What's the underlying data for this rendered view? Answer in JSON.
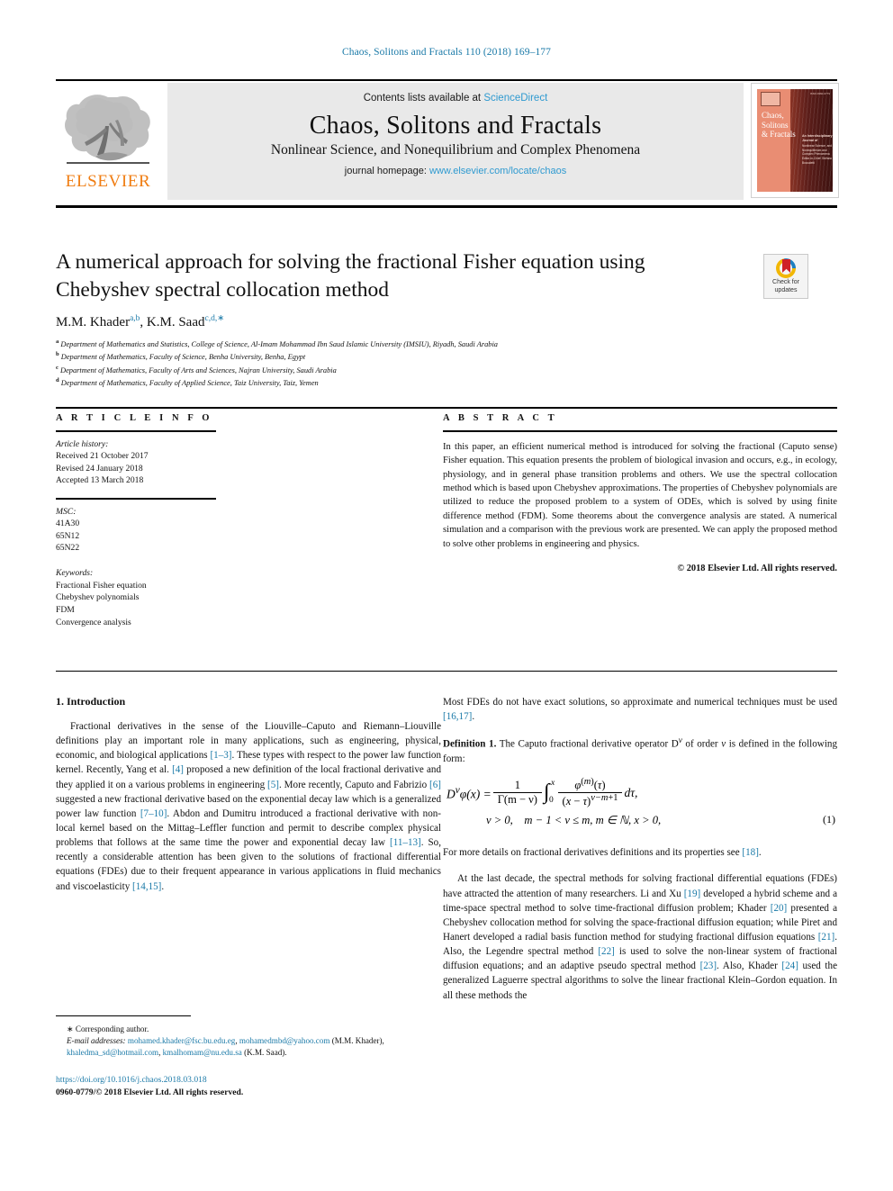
{
  "running_head": "Chaos, Solitons and Fractals 110 (2018) 169–177",
  "masthead": {
    "contents_prefix": "Contents lists available at ",
    "contents_link": "ScienceDirect",
    "journal_title": "Chaos, Solitons and Fractals",
    "journal_subtitle": "Nonlinear Science, and Nonequilibrium and Complex Phenomena",
    "homepage_label": "journal homepage: ",
    "homepage_url": "www.elsevier.com/locate/chaos",
    "publisher": "ELSEVIER",
    "publisher_color": "#f07d12",
    "link_color": "#2f9ad0",
    "cover": {
      "title_line1": "Chaos,",
      "title_line2": "Solitons",
      "title_line3": "& Fractals",
      "code": "ISSN 0960-0779",
      "blurb_bold": "An Interdisciplinary Journal of",
      "blurb": "Nonlinear Science, and Nonequilibrium and Complex Phenomena",
      "blurb_editor": "Editor-in-Chief: Stefano Boccaletti"
    }
  },
  "article": {
    "title": "A numerical approach for solving the fractional Fisher equation using Chebyshev spectral collocation method",
    "authors_html": "M.M. Khader<sup>a,b</sup>, K.M. Saad<sup>c,d,∗</sup>",
    "affiliations": [
      {
        "marker": "a",
        "text": "Department of Mathematics and Statistics, College of Science, Al-Imam Mohammad Ibn Saud Islamic University (IMSIU), Riyadh, Saudi Arabia"
      },
      {
        "marker": "b",
        "text": "Department of Mathematics, Faculty of Science, Benha University, Benha, Egypt"
      },
      {
        "marker": "c",
        "text": "Department of Mathematics, Faculty of Arts and Sciences, Najran University, Saudi Arabia"
      },
      {
        "marker": "d",
        "text": "Department of Mathematics, Faculty of Applied Science, Taiz University, Taiz, Yemen"
      }
    ],
    "crossmark": {
      "line1": "Check for",
      "line2": "updates"
    }
  },
  "article_info": {
    "heading": "A R T I C L E   I N F O",
    "history_label": "Article history:",
    "history": [
      "Received 21 October 2017",
      "Revised 24 January 2018",
      "Accepted 13 March 2018"
    ],
    "msc_label": "MSC:",
    "msc": [
      "41A30",
      "65N12",
      "65N22"
    ],
    "keywords_label": "Keywords:",
    "keywords": [
      "Fractional Fisher equation",
      "Chebyshev polynomials",
      "FDM",
      "Convergence analysis"
    ]
  },
  "abstract": {
    "heading": "A B S T R A C T",
    "text": "In this paper, an efficient numerical method is introduced for solving the fractional (Caputo sense) Fisher equation. This equation presents the problem of biological invasion and occurs, e.g., in ecology, physiology, and in general phase transition problems and others. We use the spectral collocation method which is based upon Chebyshev approximations. The properties of Chebyshev polynomials are utilized to reduce the proposed problem to a system of ODEs, which is solved by using finite difference method (FDM). Some theorems about the convergence analysis are stated. A numerical simulation and a comparison with the previous work are presented. We can apply the proposed method to solve other problems in engineering and physics.",
    "rights": "© 2018 Elsevier Ltd. All rights reserved."
  },
  "body": {
    "section1_heading": "1. Introduction",
    "left_para1_a": "Fractional derivatives in the sense of the Liouville–Caputo and Riemann–Liouville definitions play an important role in many applications, such as engineering, physical, economic, and biological applications ",
    "left_cite_1_3": "[1–3]",
    "left_para1_b": ". These types with respect to the power law function kernel. Recently, Yang et al. ",
    "left_cite_4": "[4]",
    "left_para1_c": " proposed a new definition of the local fractional derivative and they applied it on a various problems in engineering ",
    "left_cite_5": "[5]",
    "left_para1_d": ". More recently, Caputo and Fabrizio ",
    "left_cite_6": "[6]",
    "left_para1_e": " suggested a new fractional derivative based on the exponential decay law which is a generalized power law function ",
    "left_cite_7_10": "[7–10]",
    "left_para1_f": ". Abdon and Dumitru introduced a fractional derivative with non-local kernel based on the Mittag–Leffler function and permit to describe complex physical problems that follows at the same time the power and exponential decay law ",
    "left_cite_11_13": "[11–13]",
    "left_para1_g": ". So, recently a considerable attention has been given to the solutions of fractional differential equations (FDEs) due to their frequent appearance in various applications in fluid mechanics and viscoelasticity ",
    "left_cite_14_15": "[14,15]",
    "left_para1_h": ".",
    "right_para1_a": "Most FDEs do not have exact solutions, so approximate and numerical techniques must be used ",
    "right_cite_16_17": "[16,17]",
    "right_para1_b": ".",
    "definition_label": "Definition 1.",
    "definition_text": " The Caputo fractional derivative operator D",
    "definition_text2": " of order ",
    "definition_text3": " is defined in the following form:",
    "equation1": {
      "lhs": "Dνφ(x) =",
      "frac_num": "1",
      "frac_den": "Γ(m − ν)",
      "integral_upper": "x",
      "integral_lower": "0",
      "inner_num": "φ(m)(τ)",
      "inner_den": "(x − τ)ν−m+1",
      "tail": "dτ,",
      "conditions": "ν > 0, m − 1 < ν ≤ m, m ∈ ℕ, x > 0,",
      "number": "(1)"
    },
    "right_para2_a": "For more details on fractional derivatives definitions and its properties see ",
    "right_cite_18": "[18]",
    "right_para2_b": ".",
    "right_para3_a": "At the last decade, the spectral methods for solving fractional differential equations (FDEs) have attracted the attention of many researchers. Li and Xu ",
    "right_cite_19": "[19]",
    "right_para3_b": " developed a hybrid scheme and a time-space spectral method to solve time-fractional diffusion problem; Khader ",
    "right_cite_20": "[20]",
    "right_para3_c": " presented a Chebyshev collocation method for solving the space-fractional diffusion equation; while Piret and Hanert developed a radial basis function method for studying fractional diffusion equations ",
    "right_cite_21": "[21]",
    "right_para3_d": ". Also, the Legendre spectral method ",
    "right_cite_22": "[22]",
    "right_para3_e": " is used to solve the non-linear system of fractional diffusion equations; and an adaptive pseudo spectral method ",
    "right_cite_23": "[23]",
    "right_para3_f": ". Also, Khader ",
    "right_cite_24": "[24]",
    "right_para3_g": " used the generalized Laguerre spectral algorithms to solve the linear fractional Klein–Gordon equation. In all these methods the"
  },
  "footnotes": {
    "corresponding": "∗ Corresponding author.",
    "email_label": "E-mail addresses:",
    "emails": [
      "mohamed.khader@fsc.bu.edu.eg",
      "mohamedmbd@yahoo.com",
      "khaledma_sd@hotmail.com",
      "kmalhomam@nu.edu.sa"
    ],
    "email_owner1": "(M.M. Khader),",
    "email_owner2": "(K.M. Saad).",
    "doi": "https://doi.org/10.1016/j.chaos.2018.03.018",
    "issn_line": "0960-0779/© 2018 Elsevier Ltd. All rights reserved."
  },
  "colors": {
    "link": "#1b7aa8",
    "elsevier_orange": "#f07d12",
    "sciencedirect_blue": "#2f9ad0"
  }
}
